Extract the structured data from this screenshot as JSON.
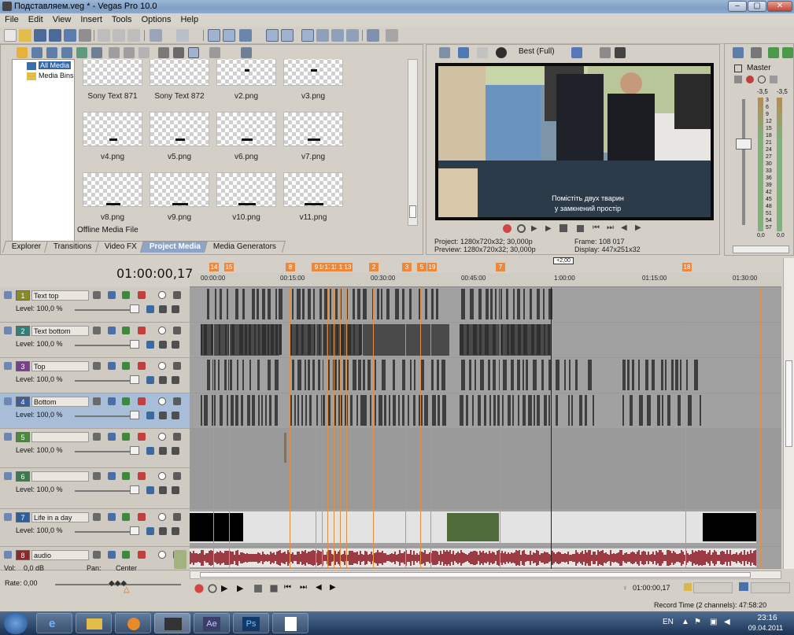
{
  "window": {
    "title": "Подставляем.veg * - Vegas Pro 10.0",
    "controls": [
      "–",
      "▢",
      "✕"
    ]
  },
  "menu": [
    "File",
    "Edit",
    "View",
    "Insert",
    "Tools",
    "Options",
    "Help"
  ],
  "media": {
    "tree": [
      "All Media",
      "Media Bins"
    ],
    "thumbs": [
      {
        "label": "Sony Text 871",
        "bar": 0
      },
      {
        "label": "Sony Text 872",
        "bar": 0
      },
      {
        "label": "v2.png",
        "bar": 2
      },
      {
        "label": "v3.png",
        "bar": 3
      },
      {
        "label": "v4.png",
        "bar": 4
      },
      {
        "label": "v5.png",
        "bar": 5
      },
      {
        "label": "v6.png",
        "bar": 6
      },
      {
        "label": "v7.png",
        "bar": 7
      },
      {
        "label": "v8.png",
        "bar": 8
      },
      {
        "label": "v9.png",
        "bar": 9
      },
      {
        "label": "v10.png",
        "bar": 10
      },
      {
        "label": "v11.png",
        "bar": 11
      }
    ],
    "offline_label": "Offline Media File",
    "tabs": [
      "Explorer",
      "Transitions",
      "Video FX",
      "Project Media",
      "Media Generators"
    ],
    "active_tab": "Project Media"
  },
  "preview": {
    "quality": "Best (Full)",
    "subtitle_line1": "Помістіть двух тварин",
    "subtitle_line2": "у замкнений простір",
    "project_label": "Project:",
    "project_value": "1280x720x32; 30,000p",
    "preview_label": "Preview:",
    "preview_value": "1280x720x32; 30,000p",
    "frame_label": "Frame:",
    "frame_value": "108 017",
    "display_label": "Display:",
    "display_value": "447x251x32"
  },
  "mixer": {
    "title": "Master",
    "db_left": "-3,5",
    "db_right": "-3,5",
    "scale": [
      "3",
      "6",
      "9",
      "12",
      "15",
      "18",
      "21",
      "24",
      "27",
      "30",
      "33",
      "36",
      "39",
      "42",
      "45",
      "48",
      "51",
      "54",
      "57"
    ],
    "bottom_left": "0,0",
    "bottom_right": "0,0"
  },
  "timeline": {
    "timecode": "01:00:00,17",
    "rate_marker": "+2,00",
    "ruler_times": [
      "00:00:00",
      "00:15:00",
      "00:30:00",
      "00:45:00",
      "1:00:00",
      "01:15:00",
      "01:30:00"
    ],
    "markers": [
      "14",
      "15",
      "8",
      "9",
      "10",
      "17",
      "11",
      "1",
      "13",
      "2",
      "3",
      "5",
      "19",
      "7",
      "18"
    ],
    "tracks": [
      {
        "num": "1",
        "name": "Text top",
        "level": "Level: 100,0 %",
        "color": "#8a8a2a"
      },
      {
        "num": "2",
        "name": "Text bottom",
        "level": "Level: 100,0 %",
        "color": "#2f7f7a"
      },
      {
        "num": "3",
        "name": "Top",
        "level": "Level: 100,0 %",
        "color": "#7a3f8a"
      },
      {
        "num": "4",
        "name": "Bottom",
        "level": "Level: 100,0 %",
        "color": "#3f5f9a"
      },
      {
        "num": "5",
        "name": "",
        "level": "Level: 100,0 %",
        "color": "#4a8a3a"
      },
      {
        "num": "6",
        "name": "",
        "level": "Level: 100,0 %",
        "color": "#3f7a4f"
      },
      {
        "num": "7",
        "name": "Life in a day",
        "level": "Level: 100,0 %",
        "color": "#2f5f9a"
      },
      {
        "num": "8",
        "name": "audio",
        "vol": "Vol:",
        "vol_value": "0,0 dB",
        "pan": "Pan:",
        "pan_value": "Center",
        "color": "#8a2a2a"
      }
    ],
    "rate_label": "Rate: 0,00",
    "end_timecode": "01:00:00,17"
  },
  "status": {
    "record_time": "Record Time (2 channels): 47:58:20"
  },
  "taskbar": {
    "apps": [
      "Windows",
      "Internet Explorer",
      "Explorer",
      "Media Player",
      "Vegas Pro",
      "Ae",
      "Ps",
      "Notepad"
    ],
    "lang": "EN",
    "time": "23:16",
    "date": "09.04.2011"
  },
  "accent": "#e9893f"
}
